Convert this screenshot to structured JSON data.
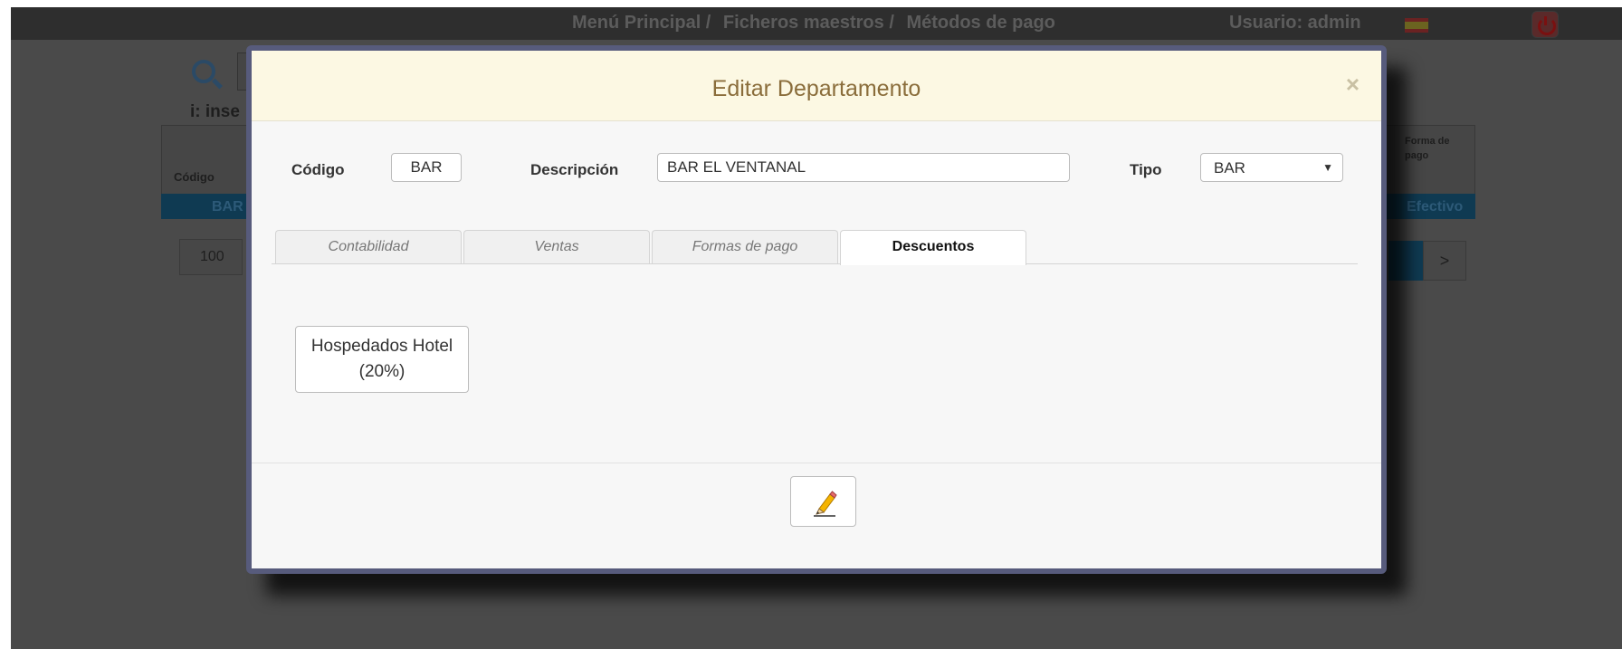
{
  "background": {
    "breadcrumb": [
      "Menú Principal /",
      "Ficheros maestros /",
      "Métodos de pago"
    ],
    "user_label": "Usuario: admin",
    "insert_hint": "i: inse",
    "table": {
      "col_codigo": "Código",
      "col_forma": "Forma de pago",
      "row_code": "BAR",
      "row_payment": "Efectivo"
    },
    "page_size": "100",
    "pager_next": ">",
    "icons": [
      "flag-es-icon",
      "power-icon",
      "search-icon"
    ]
  },
  "modal": {
    "title": "Editar Departamento",
    "close_label": "×",
    "fields": {
      "codigo_label": "Código",
      "codigo_value": "BAR",
      "descripcion_label": "Descripción",
      "descripcion_value": "BAR EL VENTANAL",
      "tipo_label": "Tipo",
      "tipo_value": "BAR",
      "tipo_arrow": "▼"
    },
    "tabs": [
      {
        "label": "Contabilidad",
        "active": false
      },
      {
        "label": "Ventas",
        "active": false
      },
      {
        "label": "Formas de pago",
        "active": false
      },
      {
        "label": "Descuentos",
        "active": true
      }
    ],
    "discounts": [
      {
        "line1": "Hospedados Hotel",
        "line2": "(20%)"
      }
    ],
    "footer": {
      "edit_icon": "pencil-icon"
    }
  },
  "colors": {
    "header_bg": "#fcf8e3",
    "title_text": "#8a6d3b",
    "modal_border": "#575b7c",
    "overlay": "#4a4a4a"
  }
}
